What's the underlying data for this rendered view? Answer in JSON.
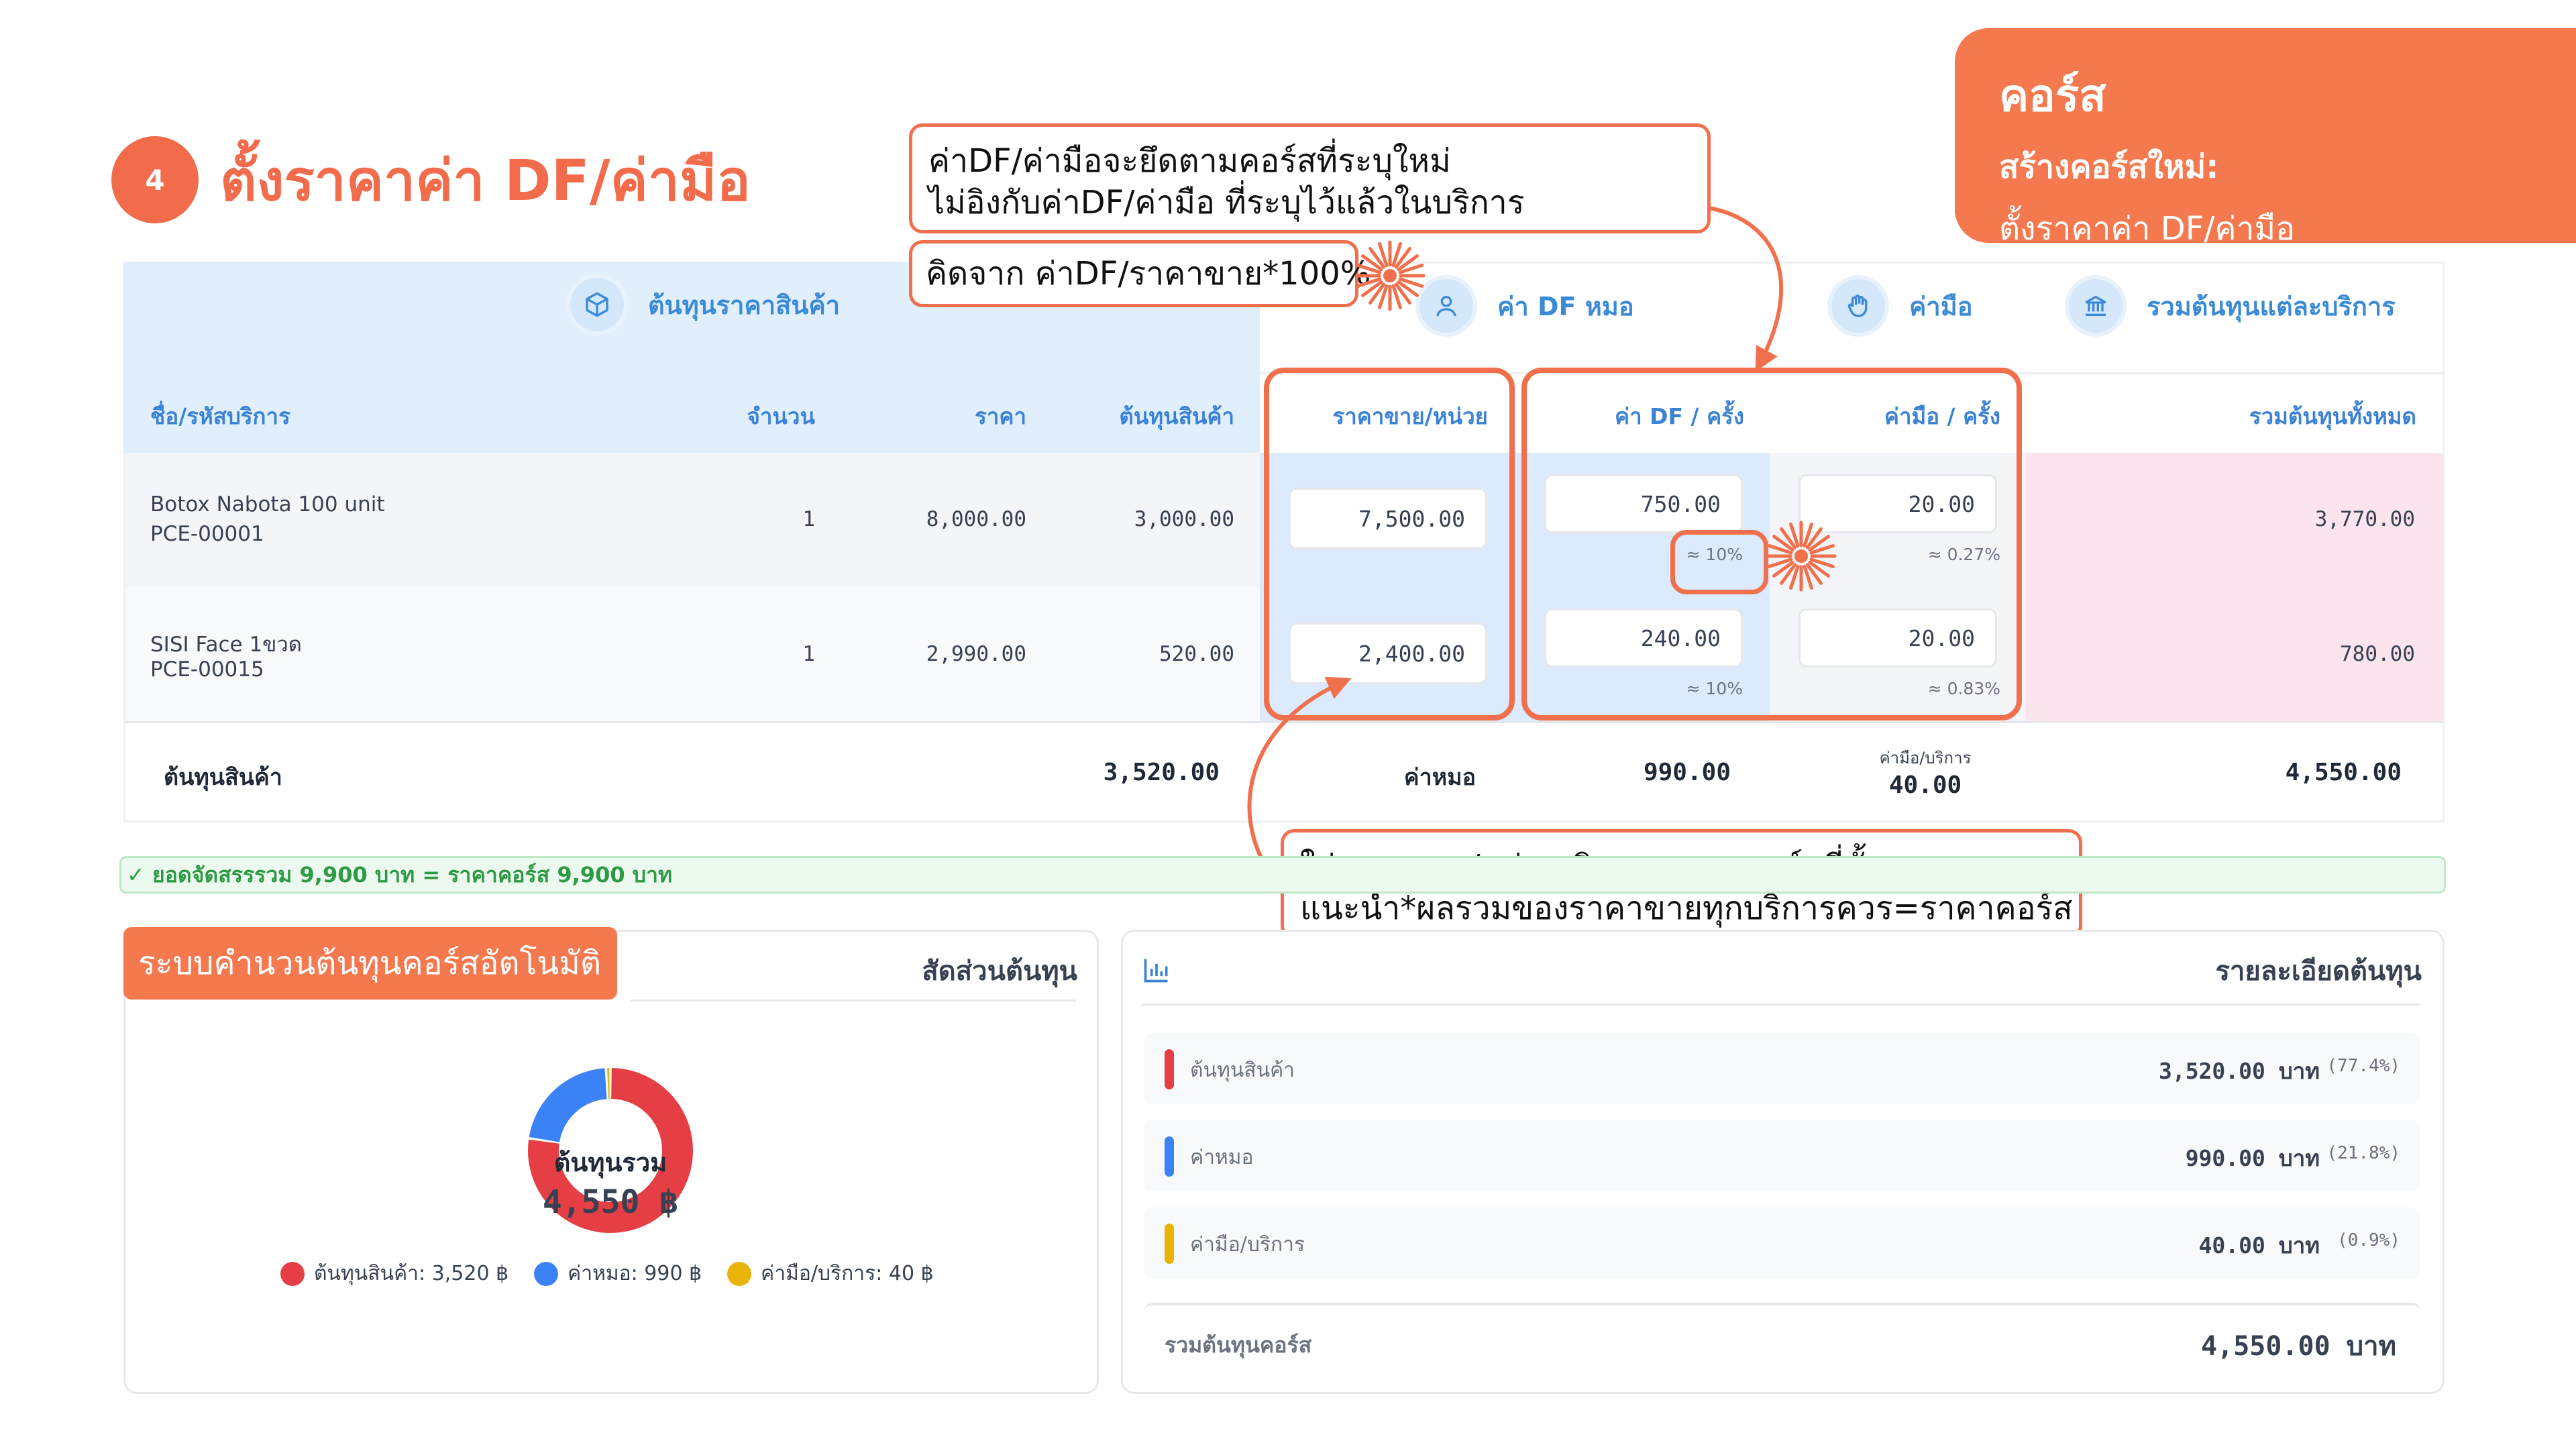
{
  "header": {
    "step_number": "4",
    "title": "ตั้งราคาค่า DF/ค่ามือ"
  },
  "corner_card": {
    "title": "คอร์ส",
    "subtitle": "สร้างคอร์สใหม่:",
    "detail": "ตั้งราคาค่า DF/ค่ามือ"
  },
  "callouts": {
    "top_line1": "ค่าDF/ค่ามือจะยึดตามคอร์สที่ระบุใหม่",
    "top_line2": "ไม่อิงกับค่าDF/ค่ามือ ที่ระบุไว้แล้วในบริการ",
    "formula": "คิดจาก ค่าDF/ราคาขาย*100%",
    "bottom_line1": "ใส่ราคาขาย/หน่วย คิดราคาจากคอร์สที่ตั้ง",
    "bottom_line2": "แนะนำ*ผลรวมของราคาขายทุกบริการควร=ราคาคอร์ส"
  },
  "table": {
    "groups": {
      "product_cost": "ต้นทุนราคาสินค้า",
      "df_fee": "ค่า DF หมอ",
      "hand_fee": "ค่ามือ",
      "total_per_service": "รวมต้นทุนแต่ละบริการ"
    },
    "columns": {
      "name": "ชื่อ/รหัสบริการ",
      "qty": "จำนวน",
      "price": "ราคา",
      "product_cost": "ต้นทุนสินค้า",
      "unit_price": "ราคาขาย/หน่วย",
      "df_per_time": "ค่า DF / ครั้ง",
      "hand_per_time": "ค่ามือ / ครั้ง",
      "total_cost": "รวมต้นทุนทั้งหมด"
    },
    "rows": [
      {
        "name": "Botox Nabota 100 unit",
        "code": "PCE-00001",
        "qty": "1",
        "price": "8,000.00",
        "product_cost": "3,000.00",
        "unit_price": "7,500.00",
        "df": "750.00",
        "df_pct": "≈ 10%",
        "hand": "20.00",
        "hand_pct": "≈ 0.27%",
        "total": "3,770.00"
      },
      {
        "name": "SISI Face 1ขวด",
        "code": "PCE-00015",
        "qty": "1",
        "price": "2,990.00",
        "product_cost": "520.00",
        "unit_price": "2,400.00",
        "df": "240.00",
        "df_pct": "≈ 10%",
        "hand": "20.00",
        "hand_pct": "≈ 0.83%",
        "total": "780.00"
      }
    ],
    "totals": {
      "product_cost_label": "ต้นทุนสินค้า",
      "product_cost_value": "3,520.00",
      "doctor_label": "ค่าหมอ",
      "doctor_value": "990.00",
      "hand_label": "ค่ามือ/บริการ",
      "hand_value": "40.00",
      "grand_total": "4,550.00"
    }
  },
  "banner": {
    "text": "✓ ยอดจัดสรรรวม 9,900 บาท = ราคาคอร์ส 9,900 บาท"
  },
  "left_panel": {
    "tag": "ระบบคำนวนต้นทุนคอร์สอัตโนมัติ",
    "title": "สัดส่วนต้นทุน",
    "donut_label": "ต้นทุนรวม",
    "donut_value": "4,550 ฿",
    "legend": [
      {
        "label": "ต้นทุนสินค้า: 3,520 ฿",
        "color": "#e53e45"
      },
      {
        "label": "ค่าหมอ: 990 ฿",
        "color": "#3b82f6"
      },
      {
        "label": "ค่ามือ/บริการ: 40 ฿",
        "color": "#eab308"
      }
    ]
  },
  "right_panel": {
    "title": "รายละเอียดต้นทุน",
    "rows": [
      {
        "label": "ต้นทุนสินค้า",
        "value": "3,520.00 บาท",
        "pct": "(77.4%)",
        "color": "#e53e45"
      },
      {
        "label": "ค่าหมอ",
        "value": "990.00 บาท",
        "pct": "(21.8%)",
        "color": "#3b82f6"
      },
      {
        "label": "ค่ามือ/บริการ",
        "value": "40.00 บาท",
        "pct": "(0.9%)",
        "color": "#eab308"
      }
    ],
    "total_label": "รวมต้นทุนคอร์ส",
    "total_value": "4,550.00 บาท"
  },
  "chart_data": {
    "type": "pie",
    "categories": [
      "ต้นทุนสินค้า",
      "ค่าหมอ",
      "ค่ามือ/บริการ"
    ],
    "values": [
      3520,
      990,
      40
    ],
    "colors": [
      "#e53e45",
      "#3b82f6",
      "#eab308"
    ],
    "title": "สัดส่วนต้นทุน",
    "center_label": "ต้นทุนรวม",
    "center_value": "4,550 ฿",
    "legend": "bottom"
  }
}
